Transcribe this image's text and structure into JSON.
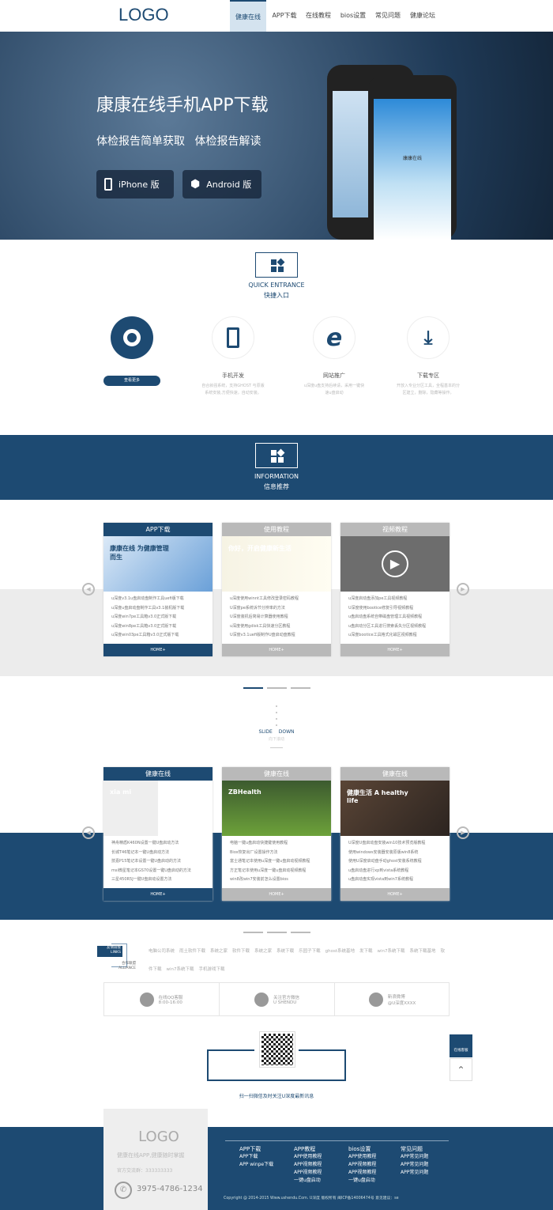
{
  "header": {
    "logo": "LOGO",
    "nav": [
      "健康在线",
      "APP下载",
      "在线教程",
      "bios设置",
      "常见问题",
      "健康论坛"
    ]
  },
  "hero": {
    "title": "康康在线手机APP下载",
    "subtitle": "体检报告简单获取  体检报告解读",
    "iphone_button": "iPhone 版",
    "android_button": "Android 版",
    "phone_app_name": "康康在线"
  },
  "quick": {
    "en": "QUICK ENTRANCE",
    "cn": "快捷入口",
    "more_button": "查看更多",
    "items": [
      {
        "title": "手机开发",
        "desc": "自合就强系统，支持GHOST 与原版系统安装,方便快速，自动安装。",
        "icon": "tablet-icon"
      },
      {
        "title": "网站推广",
        "desc": "u深度u盘支持后续请，采用一键快速u盘启动",
        "icon": "ie-icon"
      },
      {
        "title": "下载专区",
        "desc": "开放入专业分区工具，全程基本的分区建立，删除，隐藏等操作。",
        "icon": "download-icon"
      }
    ]
  },
  "info": {
    "en": "INFORMATION",
    "cn": "信息推荐"
  },
  "cards1": [
    {
      "title": "APP下载",
      "banner": "康康在线 为健康管理而生",
      "items": [
        "u深度v3.1u盘启动盘制作工具uefi版下载",
        "u深度u盘启动盘制作工具v3.1装机版下载",
        "u深度win7pe工具箱v3.0正式版下载",
        "u深度win8pe工具箱v3.0正式版下载",
        "u深度win03pe工具箱v3.0正式版下载"
      ],
      "home": "HOME+"
    },
    {
      "title": "使用教程",
      "banner": "你好，开启健康新生活",
      "items": [
        "u深度使用winnt工具修改登录密码教程",
        "U深度pe系统诉节分辨率的方法",
        "U深度装机后简易计算器使用教程",
        "u深度使用gdisk工具快速分区教程",
        "U深度v3.1uefi版制作U盘启动盘教程"
      ],
      "home": "HOME+"
    },
    {
      "title": "视频教程",
      "items": [
        "u深度启动盘添加pe工具视频教程",
        "U深度使用bootice修复引导视频教程",
        "u盘启动盘系统自带磁盘管理工具视频教程",
        "u盘启动分区工具进行搜索丢失分区视频教程",
        "u深度bootice工具格式化磁区视频教程"
      ],
      "home": "HOME+"
    }
  ],
  "slide": {
    "en1": "SLIDE",
    "en2": "DOWN",
    "cn": "向下滚动"
  },
  "cards2": [
    {
      "title": "健康在线",
      "banner": "xia mi",
      "items": [
        "神舟精盾K460N设置一键U盘启动方法",
        "长城T46笔记本一键U盘启动方法",
        "技嘉P15笔记本设置一键U盘启动的方法",
        "msi微星笔记本GS70设置一键U盘启动的方法",
        "三星450R5J一键U盘启动设置方法"
      ],
      "home": "HOME+"
    },
    {
      "title": "健康在线",
      "banner": "ZBHealth",
      "items": [
        "电脑一键u盘启动快捷键使用教程",
        "Bios恢复出厂设置操作方法",
        "富士通笔记本使用u深度一键u盘启动视频教程",
        "方正笔记本使用u深度一键u盘启动视频教程",
        "win8改win7安装前怎么设置bios"
      ],
      "home": "HOME+"
    },
    {
      "title": "健康在线",
      "banner": "健康生活 A healthy life",
      "items": [
        "U深度U盘启动盘安装win10技术预览版教程",
        "使用windows安装器安装原版win8系统",
        "使用U深度启动盘手动ghost安装系统教程",
        "u盘启动盘进行xp到vista系统教程",
        "u盘启动盘实现vista到win7系统教程"
      ],
      "home": "HOME+"
    }
  ],
  "links": {
    "friend_cn": "友情链接",
    "friend_en": "LINKS",
    "alliance_cn": "合作联盟",
    "alliance_en": "ALLIANCE",
    "items": [
      "电脑公司系统",
      "雨土软件下载",
      "系统之家",
      "软件下载",
      "系统之家",
      "系统下载",
      "乐园子下载",
      "ghost系统基地",
      "发下载",
      "win7系统下载",
      "系统下载基地",
      "软件下载",
      "win7系统下载",
      "手机游戏下载"
    ]
  },
  "contacts": [
    {
      "label": "在线QQ客服",
      "sub": "8:00-16:00",
      "icon": "qq-icon"
    },
    {
      "label": "关注官方微信",
      "sub": "U SHENDU",
      "icon": "wechat-icon"
    },
    {
      "label": "新浪微博",
      "sub": "@U深度XXXX",
      "icon": "weibo-icon"
    }
  ],
  "qr": {
    "caption": "扫一扫微信及时关注U深度最新讯息"
  },
  "side": {
    "service": "在线客服"
  },
  "footer": {
    "logo": "LOGO",
    "slogan": "健康在线APP,健康随时掌握",
    "group": "官方交流群：333333333",
    "phone": "3975-4786-1234",
    "cols": [
      {
        "head": "APP下载",
        "items": [
          "APP下载",
          "APP winpe下载"
        ]
      },
      {
        "head": "APP教程",
        "items": [
          "APP使用教程",
          "APP视频教程",
          "APP视频教程",
          "一键u盘启动"
        ]
      },
      {
        "head": "bios设置",
        "items": [
          "APP使用教程",
          "APP视频教程",
          "APP视频教程",
          "一键u盘启动"
        ]
      },
      {
        "head": "常见问题",
        "items": [
          "APP常见问题",
          "APP常见问题",
          "APP常见问题"
        ]
      }
    ],
    "copyright": "Copyright @ 2014-2015 Www.ushendu.Com. U深度 版权所有 闽ICP备14006474号 意见建议：se"
  },
  "colors": {
    "primary": "#1d4a72",
    "gray": "#b9b9b9"
  }
}
